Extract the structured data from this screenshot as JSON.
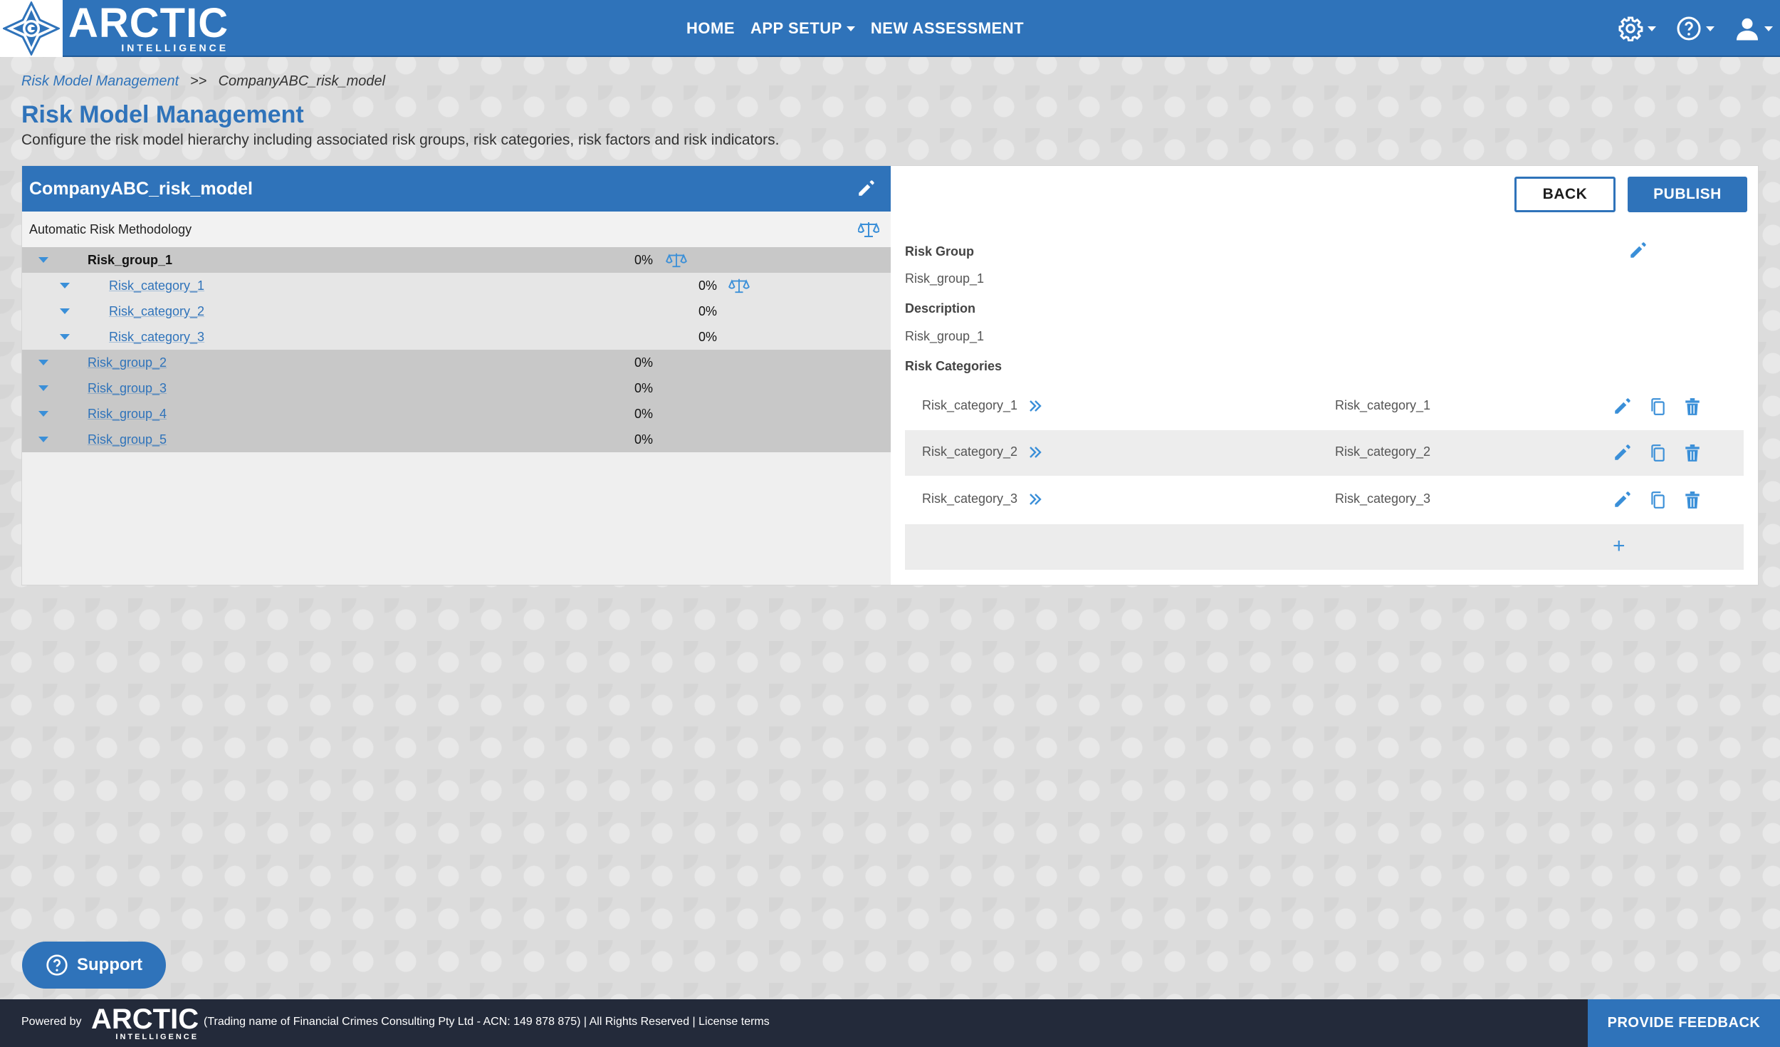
{
  "brand": {
    "name": "ARCTIC",
    "tagline": "INTELLIGENCE",
    "primary_color": "#2f73ba",
    "accent_color": "#3a8fd8"
  },
  "nav": {
    "links": [
      {
        "label": "HOME"
      },
      {
        "label": "APP SETUP",
        "has_dropdown": true
      },
      {
        "label": "NEW ASSESSMENT"
      }
    ],
    "icons": [
      "settings-icon",
      "help-icon",
      "user-icon"
    ]
  },
  "breadcrumb": {
    "parent": "Risk Model Management",
    "separator": ">>",
    "current": "CompanyABC_risk_model"
  },
  "page": {
    "title": "Risk Model Management",
    "subtitle": "Configure the risk model hierarchy including associated risk groups, risk categories, risk factors and risk indicators."
  },
  "model": {
    "name": "CompanyABC_risk_model",
    "methodology": "Automatic Risk Methodology",
    "tree": [
      {
        "type": "group",
        "label": "Risk_group_1",
        "percent": "0%",
        "active": true,
        "balance_icon": true
      },
      {
        "type": "category",
        "label": "Risk_category_1",
        "percent": "0%",
        "balance_icon": true
      },
      {
        "type": "category",
        "label": "Risk_category_2",
        "percent": "0%"
      },
      {
        "type": "category",
        "label": "Risk_category_3",
        "percent": "0%"
      },
      {
        "type": "group",
        "label": "Risk_group_2",
        "percent": "0%"
      },
      {
        "type": "group",
        "label": "Risk_group_3",
        "percent": "0%"
      },
      {
        "type": "group",
        "label": "Risk_group_4",
        "percent": "0%"
      },
      {
        "type": "group",
        "label": "Risk_group_5",
        "percent": "0%"
      }
    ]
  },
  "detail": {
    "back_label": "BACK",
    "publish_label": "PUBLISH",
    "risk_group_label": "Risk Group",
    "risk_group_value": "Risk_group_1",
    "description_label": "Description",
    "description_value": "Risk_group_1",
    "categories_label": "Risk Categories",
    "categories": [
      {
        "name": "Risk_category_1",
        "description": "Risk_category_1"
      },
      {
        "name": "Risk_category_2",
        "description": "Risk_category_2"
      },
      {
        "name": "Risk_category_3",
        "description": "Risk_category_3"
      }
    ],
    "add_label": "+"
  },
  "support": {
    "label": "Support"
  },
  "footer": {
    "powered_by": "Powered by",
    "logo_name": "ARCTIC",
    "logo_tagline": "INTELLIGENCE",
    "legal_text": "(Trading name of Financial Crimes Consulting Pty Ltd - ACN: 149 878 875) | All Rights Reserved | ",
    "license_label": "License terms",
    "feedback_label": "PROVIDE FEEDBACK"
  }
}
